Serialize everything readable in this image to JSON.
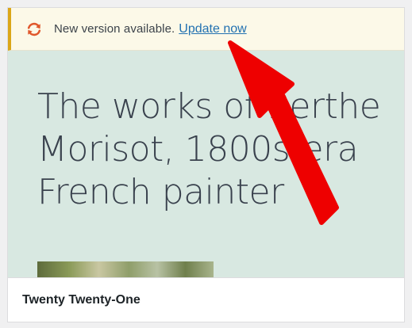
{
  "notice": {
    "message": "New version available.",
    "link_label": "Update now",
    "icon": "update-icon"
  },
  "preview": {
    "heading": "The works of Berthe Morisot, 1800s-era French painter"
  },
  "theme": {
    "name": "Twenty Twenty-One"
  },
  "colors": {
    "notice_border": "#dba617",
    "notice_bg": "#fcf9e8",
    "link": "#2271b1",
    "icon": "#d63638",
    "preview_bg": "#d8e8e1",
    "arrow": "#ee0000"
  }
}
